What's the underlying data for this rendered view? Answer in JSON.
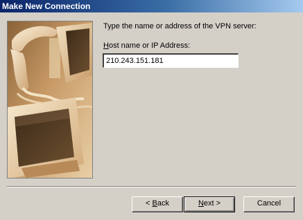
{
  "window": {
    "title": "Make New Connection"
  },
  "illustration": {
    "icon": "computer-and-phone-illustration",
    "tint": "#c8a070"
  },
  "form": {
    "prompt": "Type the name or address of the VPN server:",
    "host_label_accesskey": "H",
    "host_label_rest": "ost name or IP Address:",
    "host_value": "210.243.151.181"
  },
  "buttons": {
    "back_prefix": "< ",
    "back_accesskey": "B",
    "back_rest": "ack",
    "next_accesskey": "N",
    "next_rest": "ext >",
    "cancel_label": "Cancel"
  },
  "colors": {
    "titlebar_start": "#0a246a",
    "titlebar_end": "#a6caf0",
    "dialog_face": "#d4d0c8"
  }
}
